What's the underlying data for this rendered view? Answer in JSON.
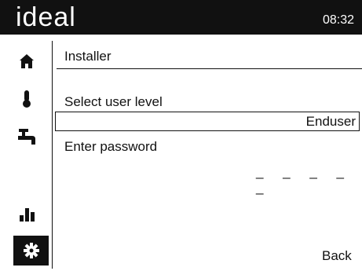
{
  "header": {
    "logo_text": "ideal",
    "time": "08:32"
  },
  "sidebar": {
    "items": [
      {
        "icon": "home-icon"
      },
      {
        "icon": "thermometer-icon"
      },
      {
        "icon": "tap-icon"
      },
      {
        "icon": "bar-chart-icon"
      },
      {
        "icon": "settings-gear-icon",
        "active": true
      }
    ]
  },
  "main": {
    "section_title": "Installer",
    "user_level_label": "Select user level",
    "user_level_value": "Enduser",
    "password_label": "Enter password",
    "password_mask": "_ _ _ _ _",
    "back_label": "Back"
  }
}
